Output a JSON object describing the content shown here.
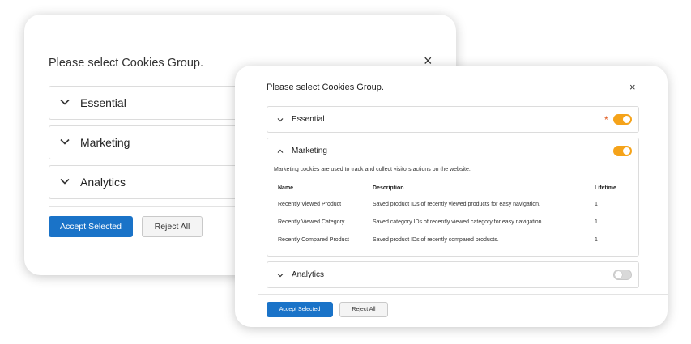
{
  "back_modal": {
    "title": "Please select Cookies Group.",
    "close_glyph": "×",
    "groups": [
      {
        "label": "Essential"
      },
      {
        "label": "Marketing"
      },
      {
        "label": "Analytics"
      }
    ],
    "accept_label": "Accept Selected",
    "reject_label": "Reject All"
  },
  "front_modal": {
    "title": "Please select Cookies Group.",
    "close_glyph": "×",
    "essential": {
      "label": "Essential",
      "required_mark": "*",
      "enabled": true
    },
    "marketing": {
      "label": "Marketing",
      "enabled": true,
      "expanded": true,
      "description": "Marketing cookies are used to track and collect visitors actions on the website.",
      "columns": [
        "Name",
        "Description",
        "Lifetime"
      ],
      "rows": [
        {
          "name": "Recently Viewed Product",
          "description": "Saved product IDs of recently viewed products for easy navigation.",
          "lifetime": "1"
        },
        {
          "name": "Recently Viewed Category",
          "description": "Saved category IDs of recently viewed category for easy navigation.",
          "lifetime": "1"
        },
        {
          "name": "Recently Compared Product",
          "description": "Saved product IDs of recently compared products.",
          "lifetime": "1"
        }
      ]
    },
    "analytics": {
      "label": "Analytics",
      "enabled": false
    },
    "accept_label": "Accept Selected",
    "reject_label": "Reject All"
  },
  "colors": {
    "accent_blue": "#1a73c8",
    "toggle_on": "#f5a31a",
    "toggle_off": "#d9d9d9",
    "required_star": "#e05a1f"
  },
  "icons": {
    "chevron_down": "chevron-down-icon",
    "chevron_up": "chevron-up-icon",
    "close": "close-icon"
  }
}
